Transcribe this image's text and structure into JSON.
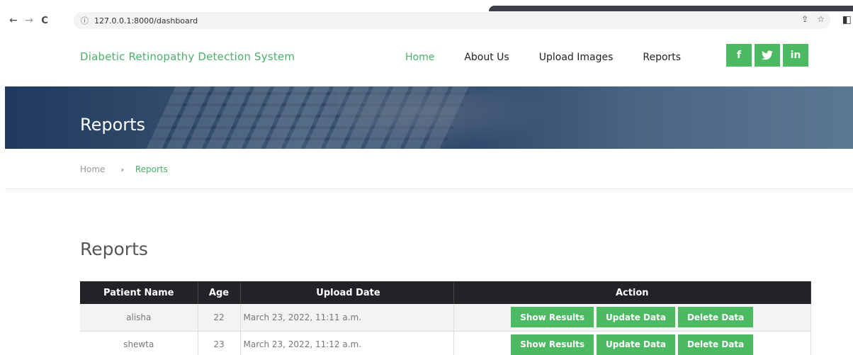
{
  "browser": {
    "back_glyph": "←",
    "forward_glyph": "→",
    "reload_glyph": "C",
    "info_glyph": "ⓘ",
    "url": "127.0.0.1:8000/dashboard",
    "share_glyph": "⇪",
    "star_glyph": "☆",
    "panel_glyph": "◧"
  },
  "header": {
    "brand": "Diabetic Retinopathy Detection System",
    "nav": {
      "home": "Home",
      "about": "About Us",
      "upload": "Upload Images",
      "reports": "Reports"
    },
    "social": {
      "facebook": "f",
      "twitter": "🐦",
      "linkedin": "in"
    }
  },
  "banner": {
    "title": "Reports"
  },
  "breadcrumb": {
    "home": "Home",
    "separator": "›",
    "current": "Reports"
  },
  "main": {
    "title": "Reports",
    "table": {
      "headers": {
        "name": "Patient Name",
        "age": "Age",
        "date": "Upload Date",
        "action": "Action"
      },
      "rows": [
        {
          "name": "alisha",
          "age": "22",
          "date": "March 23, 2022, 11:11 a.m."
        },
        {
          "name": "shewta",
          "age": "23",
          "date": "March 23, 2022, 11:12 a.m."
        }
      ],
      "actions": {
        "show": "Show Results",
        "update": "Update Data",
        "delete": "Delete Data"
      }
    }
  },
  "colors": {
    "accent": "#4caf6a",
    "button_green": "#4cba62",
    "table_header": "#222326"
  }
}
